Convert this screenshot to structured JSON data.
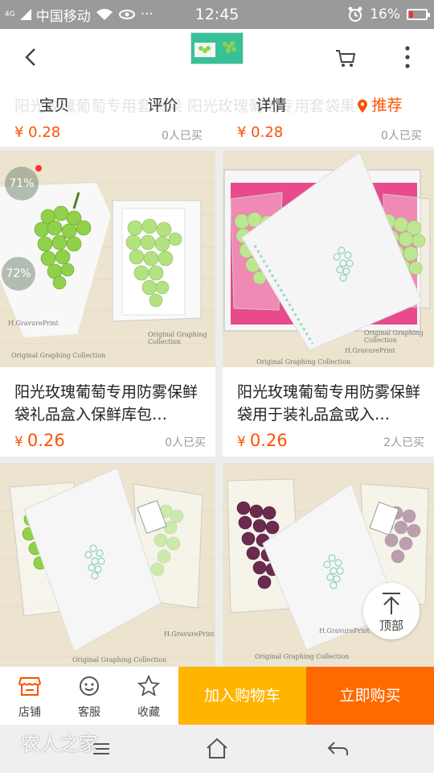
{
  "status_bar": {
    "network_tag": "4G",
    "carrier": "中国移动",
    "extra_icons": "···",
    "time": "12:45",
    "battery_percent": "16%"
  },
  "header": {
    "back_icon": "chevron-left-icon",
    "cart_icon": "cart-icon",
    "more_icon": "more-vertical-icon",
    "ghost_title": "阳光玫瑰葡萄专用套袋果    阳光玫瑰葡萄专用套袋果",
    "tabs": [
      {
        "label": "宝贝"
      },
      {
        "label": "评价"
      },
      {
        "label": "详情"
      },
      {
        "label": "推荐",
        "icon": "location-pin-icon",
        "active": true
      }
    ],
    "prev_row": [
      {
        "price": "¥ 0.28",
        "sold": "0人已买"
      },
      {
        "price": "¥ 0.28",
        "sold": "0人已买"
      }
    ]
  },
  "products": [
    {
      "title": "阳光玫瑰葡萄专用防雾保鲜袋礼品盒入保鲜库包…",
      "currency": "¥",
      "price": "0.26",
      "sold": "0人已买",
      "badges": [
        "71%",
        "72%"
      ]
    },
    {
      "title": "阳光玫瑰葡萄专用防雾保鲜袋用于装礼品盒或入…",
      "currency": "¥",
      "price": "0.26",
      "sold": "2人已买"
    },
    {
      "title": "",
      "currency": "",
      "price": "",
      "sold": ""
    },
    {
      "title": "",
      "currency": "",
      "price": "",
      "sold": ""
    }
  ],
  "image_text": {
    "newsprint_1": "H.GravurePrint",
    "newsprint_2": "Original Graphing Collection"
  },
  "back_to_top": {
    "label": "顶部",
    "icon": "arrow-up-icon"
  },
  "action_bar": {
    "shop_label": "店铺",
    "service_label": "客服",
    "favorite_label": "收藏",
    "add_cart_label": "加入购物车",
    "buy_now_label": "立即购买"
  },
  "watermark": "农人之家",
  "colors": {
    "accent": "#ff5000",
    "add_cart": "#ffb400",
    "buy_now": "#ff6a00",
    "status_bar": "#9a9a9a"
  }
}
